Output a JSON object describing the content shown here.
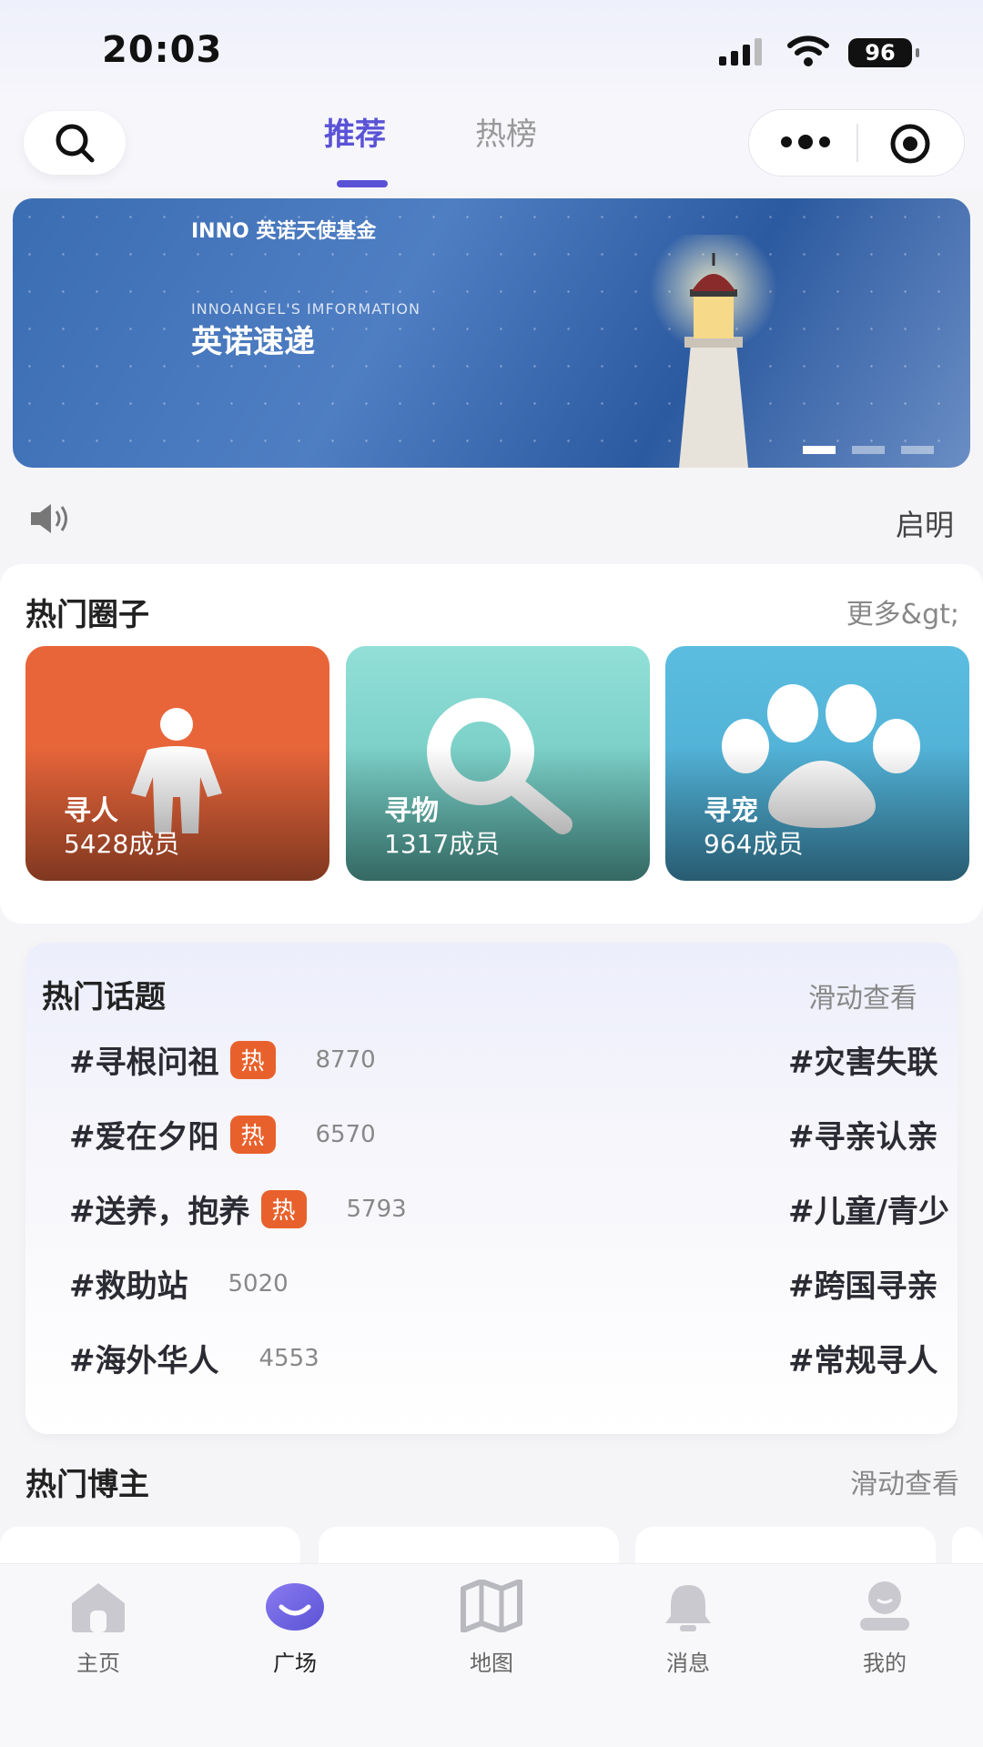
{
  "status_bar": {
    "time": "20:03",
    "battery": "96"
  },
  "header": {
    "tabs": [
      {
        "label": "推荐",
        "active": true
      },
      {
        "label": "热榜",
        "active": false
      }
    ],
    "accent_color": "#5a52d6"
  },
  "banner": {
    "logo_text": "INNO 英诺天使基金",
    "subtitle": "INNOANGEL'S IMFORMATION",
    "title": "英诺速递",
    "pages": 3,
    "active_page": 1
  },
  "notice": {
    "text": "启明",
    "icon": "speaker-icon"
  },
  "hot_circles": {
    "title": "热门圈子",
    "more": "更多&gt;",
    "items": [
      {
        "name": "寻人",
        "count": "5428成员",
        "color": "#e8653a",
        "icon": "person-icon"
      },
      {
        "name": "寻物",
        "count": "1317成员",
        "color": "#6fcfc8",
        "icon": "magnifier-icon"
      },
      {
        "name": "寻宠",
        "count": "964成员",
        "color": "#56b4d8",
        "icon": "paw-icon"
      }
    ]
  },
  "hot_topics": {
    "title": "热门话题",
    "hint": "滑动查看",
    "badge": "热",
    "left_column": [
      {
        "tag": "#寻根问祖",
        "hot": true,
        "count": "8770"
      },
      {
        "tag": "#爱在夕阳",
        "hot": true,
        "count": "6570"
      },
      {
        "tag": "#送养，抱养",
        "hot": true,
        "count": "5793"
      },
      {
        "tag": "#救助站",
        "hot": false,
        "count": "5020"
      },
      {
        "tag": "#海外华人",
        "hot": false,
        "count": "4553"
      }
    ],
    "right_column": [
      "#灾害失联",
      "#寻亲认亲",
      "#儿童/青少",
      "#跨国寻亲",
      "#常规寻人"
    ]
  },
  "hot_bloggers": {
    "title": "热门博主",
    "hint": "滑动查看"
  },
  "tab_bar": [
    {
      "label": "主页",
      "icon": "home-icon",
      "active": false
    },
    {
      "label": "广场",
      "icon": "plaza-icon",
      "active": true
    },
    {
      "label": "地图",
      "icon": "map-icon",
      "active": false
    },
    {
      "label": "消息",
      "icon": "bell-icon",
      "active": false
    },
    {
      "label": "我的",
      "icon": "profile-icon",
      "active": false
    }
  ]
}
